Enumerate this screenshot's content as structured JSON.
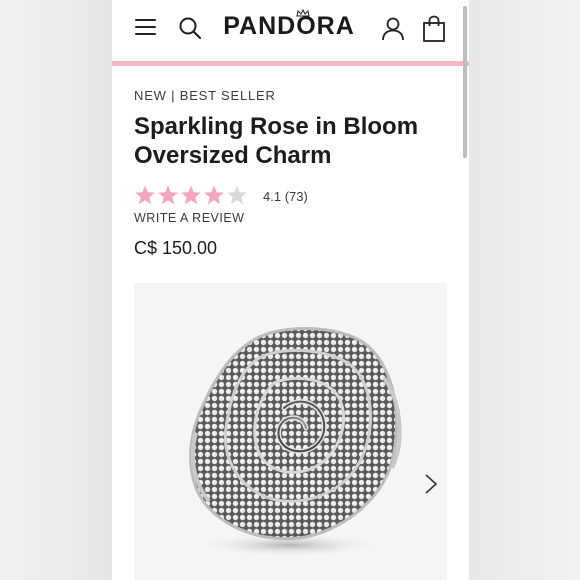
{
  "header": {
    "brand": "PANDORA",
    "icons": [
      "menu-icon",
      "search-icon",
      "account-icon",
      "shopping-bag-icon"
    ]
  },
  "product": {
    "eyebrow": "NEW | BEST SELLER",
    "title": "Sparkling Rose in Bloom Oversized Charm",
    "rating": 4.1,
    "rating_value": "4.1",
    "review_count": "(73)",
    "stars_total": 5,
    "write_review": "WRITE A REVIEW",
    "price": "C$ 150.00"
  },
  "colors": {
    "brand_pink": "#f4b8c6",
    "star_pink": "#f3a6bd",
    "star_empty": "#d9d9d9",
    "text": "#1c1c1c"
  }
}
